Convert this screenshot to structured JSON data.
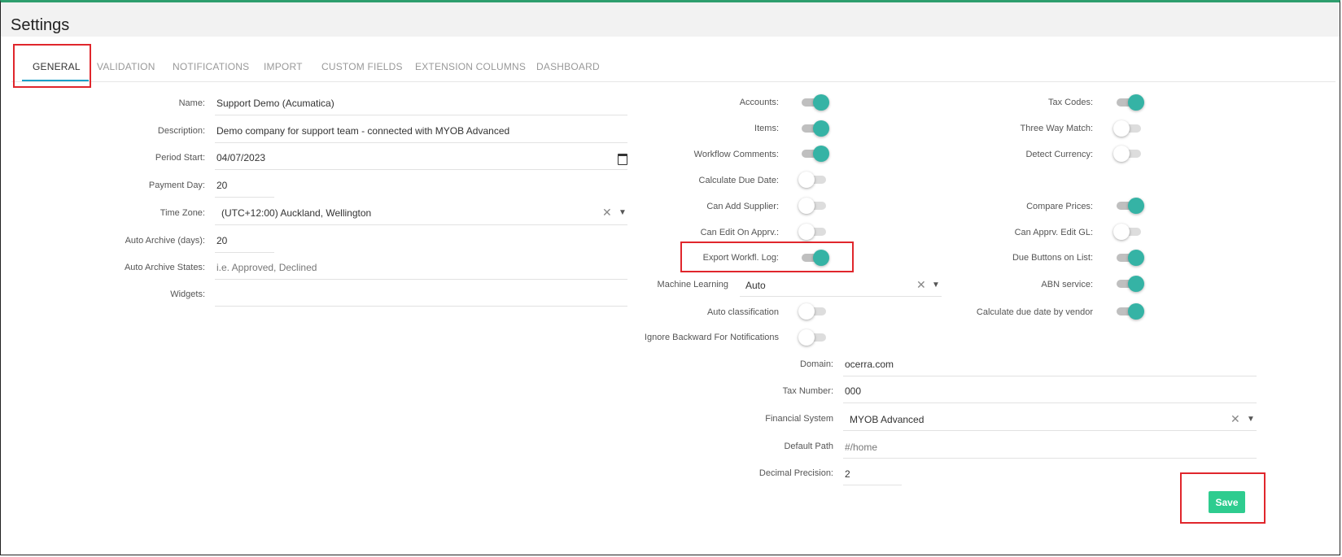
{
  "page": {
    "title": "Settings"
  },
  "tabs": [
    {
      "label": "GENERAL"
    },
    {
      "label": "VALIDATION"
    },
    {
      "label": "NOTIFICATIONS"
    },
    {
      "label": "IMPORT"
    },
    {
      "label": "CUSTOM FIELDS"
    },
    {
      "label": "EXTENSION COLUMNS"
    },
    {
      "label": "DASHBOARD"
    }
  ],
  "form": {
    "name": {
      "label": "Name:",
      "value": "Support Demo (Acumatica)"
    },
    "description": {
      "label": "Description:",
      "value": "Demo company for support team - connected with MYOB Advanced"
    },
    "period_start": {
      "label": "Period Start:",
      "value": "04/07/2023"
    },
    "payment_day": {
      "label": "Payment Day:",
      "value": "20"
    },
    "time_zone": {
      "label": "Time Zone:",
      "value": "(UTC+12:00) Auckland, Wellington"
    },
    "auto_archive_days": {
      "label": "Auto Archive (days):",
      "value": "20"
    },
    "auto_archive_states": {
      "label": "Auto Archive States:",
      "placeholder": "i.e. Approved, Declined"
    },
    "widgets": {
      "label": "Widgets:",
      "value": ""
    }
  },
  "toggles_mid": [
    {
      "label": "Accounts:",
      "on": true
    },
    {
      "label": "Items:",
      "on": true
    },
    {
      "label": "Workflow Comments:",
      "on": true
    },
    {
      "label": "Calculate Due Date:",
      "on": false
    },
    {
      "label": "Can Add Supplier:",
      "on": false
    },
    {
      "label": "Can Edit On Apprv.:",
      "on": false
    },
    {
      "label": "Export Workfl. Log:",
      "on": true
    }
  ],
  "machine_learning": {
    "label": "Machine Learning",
    "value": "Auto"
  },
  "toggles_mid_lower": [
    {
      "label": "Auto classification",
      "on": false
    },
    {
      "label": "Ignore Backward For Notifications",
      "on": false
    }
  ],
  "toggles_right": [
    {
      "label": "Tax Codes:",
      "on": true
    },
    {
      "label": "Three Way Match:",
      "on": false
    },
    {
      "label": "Detect Currency:",
      "on": false
    },
    {
      "label": "Compare Prices:",
      "on": true
    },
    {
      "label": "Can Apprv. Edit GL:",
      "on": false
    },
    {
      "label": "Due Buttons on List:",
      "on": true
    },
    {
      "label": "ABN service:",
      "on": true
    },
    {
      "label": "Calculate due date by vendor",
      "on": true
    }
  ],
  "lower_form": {
    "domain": {
      "label": "Domain:",
      "value": "ocerra.com"
    },
    "tax_number": {
      "label": "Tax Number:",
      "value": "000"
    },
    "financial_system": {
      "label": "Financial System",
      "value": "MYOB Advanced"
    },
    "default_path": {
      "label": "Default Path",
      "placeholder": "#/home"
    },
    "decimal_precision": {
      "label": "Decimal Precision:",
      "value": "2"
    }
  },
  "actions": {
    "save_label": "Save"
  },
  "colors": {
    "toggle_on": "#35b3a5",
    "save_button": "#2ecc8f",
    "tab_underline": "#1aa0c8",
    "highlight": "#e0262c"
  }
}
